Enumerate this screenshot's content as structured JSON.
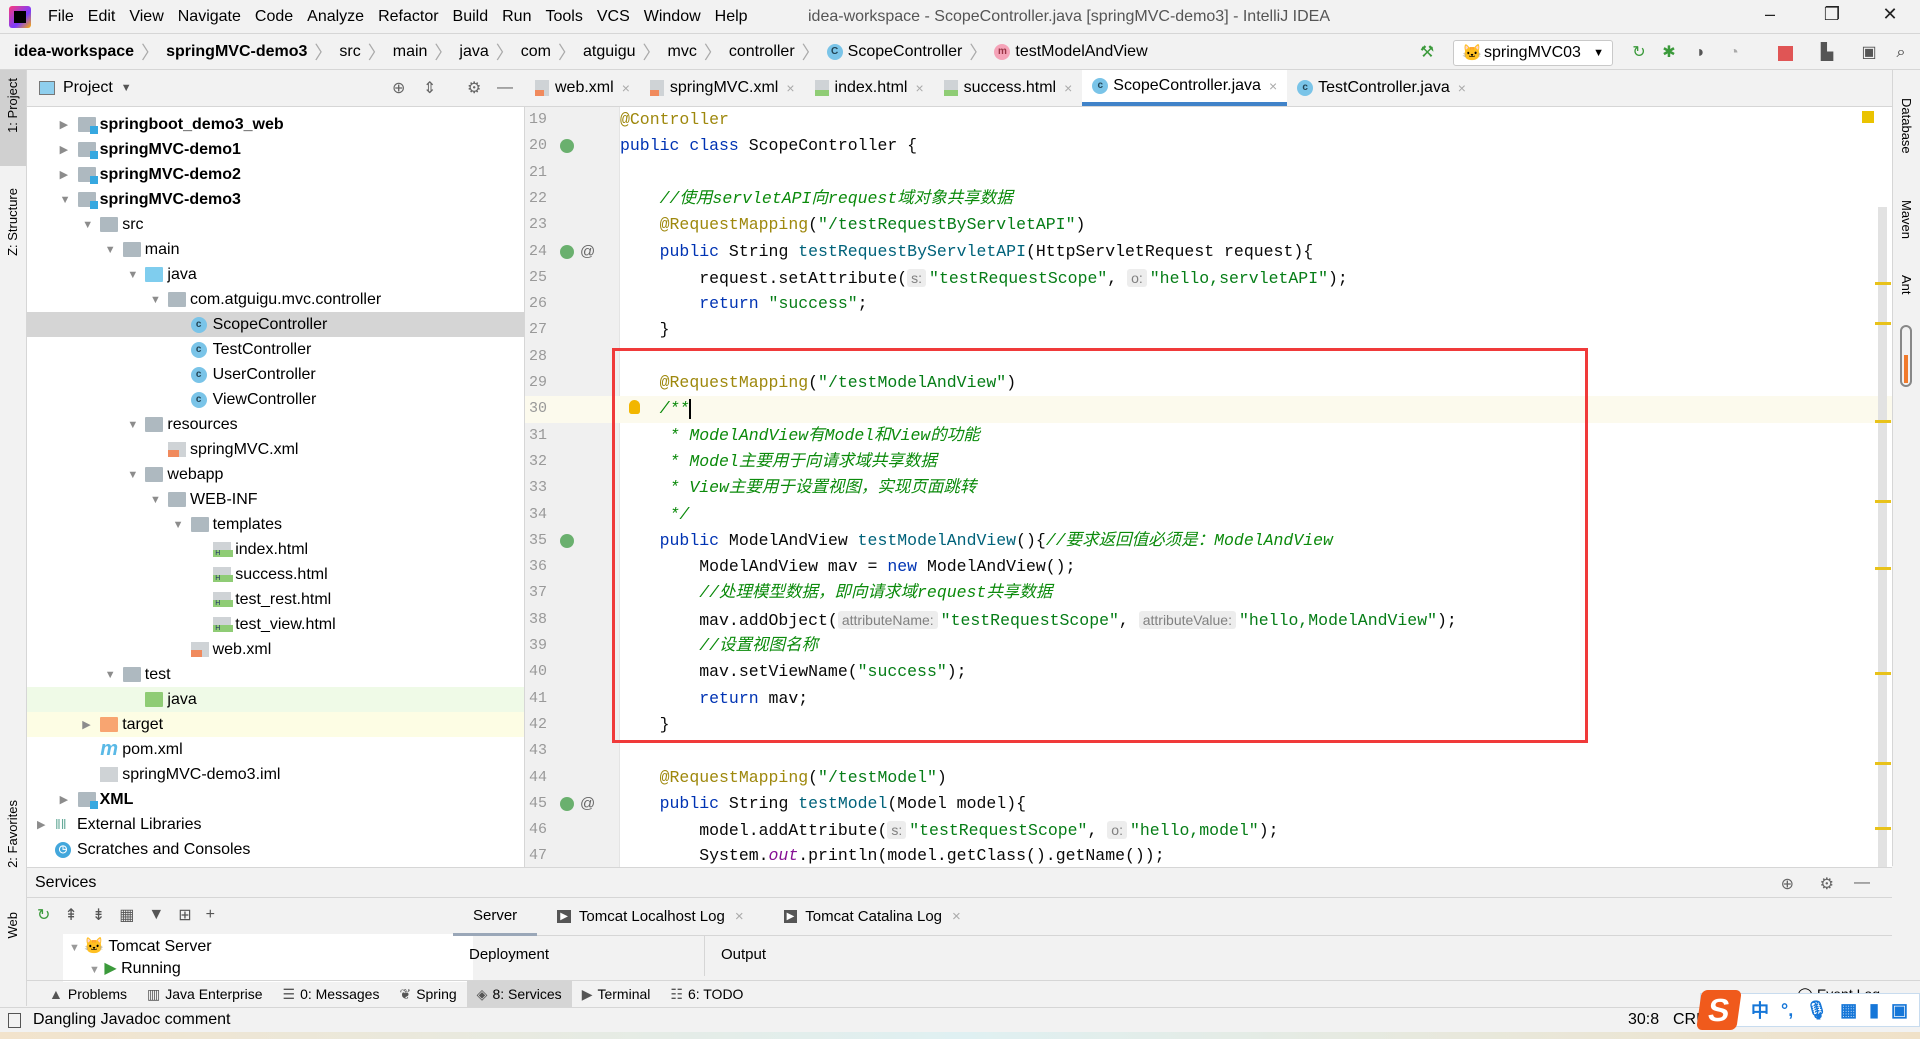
{
  "menubar": {
    "items": [
      "File",
      "Edit",
      "View",
      "Navigate",
      "Code",
      "Analyze",
      "Refactor",
      "Build",
      "Run",
      "Tools",
      "VCS",
      "Window",
      "Help"
    ],
    "title": "idea-workspace - ScopeController.java [springMVC-demo3] - IntelliJ IDEA",
    "window_controls": [
      "minimize",
      "restore",
      "close"
    ]
  },
  "breadcrumb": {
    "items": [
      "idea-workspace",
      "springMVC-demo3",
      "src",
      "main",
      "java",
      "com",
      "atguigu",
      "mvc",
      "controller",
      "ScopeController",
      "testModelAndView"
    ],
    "run_config": "springMVC03"
  },
  "left_strip": {
    "labels": [
      "1: Project",
      "Z: Structure",
      "2: Favorites",
      "Web"
    ]
  },
  "right_strip": {
    "labels": [
      "Database",
      "Maven",
      "Ant"
    ]
  },
  "project": {
    "title": "Project",
    "tree": [
      {
        "label": "springboot_demo3_web",
        "level": 1,
        "arrow": "collapsed",
        "icon": "module-folder",
        "bold": true
      },
      {
        "label": "springMVC-demo1",
        "level": 1,
        "arrow": "collapsed",
        "icon": "module-folder",
        "bold": true
      },
      {
        "label": "springMVC-demo2",
        "level": 1,
        "arrow": "collapsed",
        "icon": "module-folder",
        "bold": true
      },
      {
        "label": "springMVC-demo3",
        "level": 1,
        "arrow": "expanded",
        "icon": "module-folder",
        "bold": true
      },
      {
        "label": "src",
        "level": 2,
        "arrow": "expanded",
        "icon": "folder"
      },
      {
        "label": "main",
        "level": 3,
        "arrow": "expanded",
        "icon": "folder"
      },
      {
        "label": "java",
        "level": 4,
        "arrow": "expanded",
        "icon": "source-folder"
      },
      {
        "label": "com.atguigu.mvc.controller",
        "level": 5,
        "arrow": "expanded",
        "icon": "package"
      },
      {
        "label": "ScopeController",
        "level": 6,
        "icon": "class",
        "selected": true
      },
      {
        "label": "TestController",
        "level": 6,
        "icon": "class"
      },
      {
        "label": "UserController",
        "level": 6,
        "icon": "class"
      },
      {
        "label": "ViewController",
        "level": 6,
        "icon": "class"
      },
      {
        "label": "resources",
        "level": 4,
        "arrow": "expanded",
        "icon": "resources-folder"
      },
      {
        "label": "springMVC.xml",
        "level": 5,
        "icon": "xml-file"
      },
      {
        "label": "webapp",
        "level": 4,
        "arrow": "expanded",
        "icon": "web-folder"
      },
      {
        "label": "WEB-INF",
        "level": 5,
        "arrow": "expanded",
        "icon": "folder"
      },
      {
        "label": "templates",
        "level": 6,
        "arrow": "expanded",
        "icon": "folder"
      },
      {
        "label": "index.html",
        "level": 7,
        "icon": "html-file"
      },
      {
        "label": "success.html",
        "level": 7,
        "icon": "html-file"
      },
      {
        "label": "test_rest.html",
        "level": 7,
        "icon": "html-file"
      },
      {
        "label": "test_view.html",
        "level": 7,
        "icon": "html-file"
      },
      {
        "label": "web.xml",
        "level": 6,
        "icon": "xml-file"
      },
      {
        "label": "test",
        "level": 3,
        "arrow": "expanded",
        "icon": "folder"
      },
      {
        "label": "java",
        "level": 4,
        "icon": "test-folder",
        "highlight": "green"
      },
      {
        "label": "target",
        "level": 2,
        "arrow": "collapsed",
        "icon": "excluded-folder",
        "highlight": "yellow"
      },
      {
        "label": "pom.xml",
        "level": 2,
        "icon": "maven-file"
      },
      {
        "label": "springMVC-demo3.iml",
        "level": 2,
        "icon": "iml-file"
      },
      {
        "label": "XML",
        "level": 1,
        "arrow": "collapsed",
        "icon": "module-folder",
        "bold": true
      },
      {
        "label": "External Libraries",
        "level": 0,
        "arrow": "collapsed",
        "icon": "libraries"
      },
      {
        "label": "Scratches and Consoles",
        "level": 0,
        "icon": "scratches"
      }
    ]
  },
  "editor": {
    "tabs": [
      {
        "label": "web.xml",
        "icon": "xml"
      },
      {
        "label": "springMVC.xml",
        "icon": "xml"
      },
      {
        "label": "index.html",
        "icon": "html"
      },
      {
        "label": "success.html",
        "icon": "html"
      },
      {
        "label": "ScopeController.java",
        "icon": "class",
        "active": true
      },
      {
        "label": "TestController.java",
        "icon": "class"
      }
    ],
    "current_line": 30,
    "highlight_box_lines": [
      28,
      42
    ],
    "lines": [
      {
        "n": 19,
        "tokens": [
          {
            "t": "ann",
            "v": "@Controller"
          }
        ]
      },
      {
        "n": 20,
        "gutter": "bean",
        "tokens": [
          {
            "t": "kw",
            "v": "public"
          },
          {
            "t": "plain",
            "v": " "
          },
          {
            "t": "kw",
            "v": "class"
          },
          {
            "t": "plain",
            "v": " ScopeController {"
          }
        ]
      },
      {
        "n": 21,
        "tokens": []
      },
      {
        "n": 22,
        "tokens": [
          {
            "t": "plain",
            "v": "    "
          },
          {
            "t": "cmt",
            "v": "//使用servletAPI向request域对象共享数据"
          }
        ]
      },
      {
        "n": 23,
        "tokens": [
          {
            "t": "plain",
            "v": "    "
          },
          {
            "t": "ann",
            "v": "@RequestMapping"
          },
          {
            "t": "plain",
            "v": "("
          },
          {
            "t": "str",
            "v": "\"/testRequestByServletAPI\""
          },
          {
            "t": "plain",
            "v": ")"
          }
        ]
      },
      {
        "n": 24,
        "gutter": "bean",
        "at": true,
        "tokens": [
          {
            "t": "plain",
            "v": "    "
          },
          {
            "t": "kw",
            "v": "public"
          },
          {
            "t": "plain",
            "v": " String "
          },
          {
            "t": "fn",
            "v": "testRequestByServletAPI"
          },
          {
            "t": "plain",
            "v": "(HttpServletRequest request){"
          }
        ]
      },
      {
        "n": 25,
        "tokens": [
          {
            "t": "plain",
            "v": "        request.setAttribute("
          },
          {
            "t": "hint",
            "v": "s:"
          },
          {
            "t": "str",
            "v": "\"testRequestScope\""
          },
          {
            "t": "plain",
            "v": ", "
          },
          {
            "t": "hint",
            "v": "o:"
          },
          {
            "t": "str",
            "v": "\"hello,servletAPI\""
          },
          {
            "t": "plain",
            "v": ");"
          }
        ]
      },
      {
        "n": 26,
        "tokens": [
          {
            "t": "plain",
            "v": "        "
          },
          {
            "t": "kw",
            "v": "return"
          },
          {
            "t": "plain",
            "v": " "
          },
          {
            "t": "str",
            "v": "\"success\""
          },
          {
            "t": "plain",
            "v": ";"
          }
        ]
      },
      {
        "n": 27,
        "tokens": [
          {
            "t": "plain",
            "v": "    }"
          }
        ]
      },
      {
        "n": 28,
        "tokens": []
      },
      {
        "n": 29,
        "tokens": [
          {
            "t": "plain",
            "v": "    "
          },
          {
            "t": "ann",
            "v": "@RequestMapping"
          },
          {
            "t": "plain",
            "v": "("
          },
          {
            "t": "str",
            "v": "\"/testModelAndView\""
          },
          {
            "t": "plain",
            "v": ")"
          }
        ]
      },
      {
        "n": 30,
        "bulb": true,
        "caret": true,
        "tokens": [
          {
            "t": "plain",
            "v": "    "
          },
          {
            "t": "cmt",
            "v": "/**"
          }
        ]
      },
      {
        "n": 31,
        "tokens": [
          {
            "t": "plain",
            "v": "     "
          },
          {
            "t": "cmt",
            "v": "* ModelAndView有Model和View的功能"
          }
        ]
      },
      {
        "n": 32,
        "tokens": [
          {
            "t": "plain",
            "v": "     "
          },
          {
            "t": "cmt",
            "v": "* Model主要用于向请求域共享数据"
          }
        ]
      },
      {
        "n": 33,
        "tokens": [
          {
            "t": "plain",
            "v": "     "
          },
          {
            "t": "cmt",
            "v": "* View主要用于设置视图，实现页面跳转"
          }
        ]
      },
      {
        "n": 34,
        "tokens": [
          {
            "t": "plain",
            "v": "     "
          },
          {
            "t": "cmt",
            "v": "*/"
          }
        ]
      },
      {
        "n": 35,
        "gutter": "bean",
        "tokens": [
          {
            "t": "plain",
            "v": "    "
          },
          {
            "t": "kw",
            "v": "public"
          },
          {
            "t": "plain",
            "v": " ModelAndView "
          },
          {
            "t": "fn",
            "v": "testModelAndView"
          },
          {
            "t": "plain",
            "v": "(){"
          },
          {
            "t": "cmt",
            "v": "//要求返回值必须是：ModelAndView"
          }
        ]
      },
      {
        "n": 36,
        "tokens": [
          {
            "t": "plain",
            "v": "        ModelAndView mav = "
          },
          {
            "t": "kw",
            "v": "new"
          },
          {
            "t": "plain",
            "v": " ModelAndView();"
          }
        ]
      },
      {
        "n": 37,
        "tokens": [
          {
            "t": "plain",
            "v": "        "
          },
          {
            "t": "cmt",
            "v": "//处理模型数据，即向请求域request共享数据"
          }
        ]
      },
      {
        "n": 38,
        "tokens": [
          {
            "t": "plain",
            "v": "        mav.addObject("
          },
          {
            "t": "hint",
            "v": "attributeName:"
          },
          {
            "t": "str",
            "v": "\"testRequestScope\""
          },
          {
            "t": "plain",
            "v": ", "
          },
          {
            "t": "hint",
            "v": "attributeValue:"
          },
          {
            "t": "str",
            "v": "\"hello,ModelAndView\""
          },
          {
            "t": "plain",
            "v": ");"
          }
        ]
      },
      {
        "n": 39,
        "tokens": [
          {
            "t": "plain",
            "v": "        "
          },
          {
            "t": "cmt",
            "v": "//设置视图名称"
          }
        ]
      },
      {
        "n": 40,
        "tokens": [
          {
            "t": "plain",
            "v": "        mav.setViewName("
          },
          {
            "t": "str",
            "v": "\"success\""
          },
          {
            "t": "plain",
            "v": ");"
          }
        ]
      },
      {
        "n": 41,
        "tokens": [
          {
            "t": "plain",
            "v": "        "
          },
          {
            "t": "kw",
            "v": "return"
          },
          {
            "t": "plain",
            "v": " mav;"
          }
        ]
      },
      {
        "n": 42,
        "tokens": [
          {
            "t": "plain",
            "v": "    }"
          }
        ]
      },
      {
        "n": 43,
        "tokens": []
      },
      {
        "n": 44,
        "tokens": [
          {
            "t": "plain",
            "v": "    "
          },
          {
            "t": "ann",
            "v": "@RequestMapping"
          },
          {
            "t": "plain",
            "v": "("
          },
          {
            "t": "str",
            "v": "\"/testModel\""
          },
          {
            "t": "plain",
            "v": ")"
          }
        ]
      },
      {
        "n": 45,
        "gutter": "bean",
        "at": true,
        "tokens": [
          {
            "t": "plain",
            "v": "    "
          },
          {
            "t": "kw",
            "v": "public"
          },
          {
            "t": "plain",
            "v": " String "
          },
          {
            "t": "fn",
            "v": "testModel"
          },
          {
            "t": "plain",
            "v": "(Model model){"
          }
        ]
      },
      {
        "n": 46,
        "tokens": [
          {
            "t": "plain",
            "v": "        model.addAttribute("
          },
          {
            "t": "hint",
            "v": "s:"
          },
          {
            "t": "str",
            "v": "\"testRequestScope\""
          },
          {
            "t": "plain",
            "v": ", "
          },
          {
            "t": "hint",
            "v": "o:"
          },
          {
            "t": "str",
            "v": "\"hello,model\""
          },
          {
            "t": "plain",
            "v": ");"
          }
        ]
      },
      {
        "n": 47,
        "tokens": [
          {
            "t": "plain",
            "v": "        System."
          },
          {
            "t": "static",
            "v": "out"
          },
          {
            "t": "plain",
            "v": ".println(model.getClass().getName());"
          }
        ]
      }
    ]
  },
  "services": {
    "title": "Services",
    "tree": [
      "Tomcat Server",
      "Running"
    ],
    "tabs": [
      {
        "label": "Server",
        "active": true
      },
      {
        "label": "Tomcat Localhost Log"
      },
      {
        "label": "Tomcat Catalina Log"
      }
    ],
    "columns": [
      "Deployment",
      "Output"
    ]
  },
  "tool_buttons": [
    {
      "label": "Problems",
      "icon": "warning"
    },
    {
      "label": "Java Enterprise",
      "icon": "java-ee"
    },
    {
      "label": "0: Messages",
      "icon": "messages"
    },
    {
      "label": "Spring",
      "icon": "spring"
    },
    {
      "label": "8: Services",
      "icon": "services",
      "active": true
    },
    {
      "label": "Terminal",
      "icon": "terminal"
    },
    {
      "label": "6: TODO",
      "icon": "todo"
    }
  ],
  "event_log": "Event Log",
  "status": {
    "message": "Dangling Javadoc comment",
    "position": "30:8",
    "line_sep": "CRL"
  },
  "ime": {
    "logo": "S",
    "items": [
      "中",
      "°,",
      "🎤",
      "▦",
      "👕",
      "▣"
    ]
  },
  "colors": {
    "accent": "#4083c9",
    "highlight_box": "#f03a3a",
    "current_line": "#fcfaed",
    "keyword": "#0033b3",
    "string": "#067d17",
    "comment": "#0b8a0b",
    "annotation": "#9e880d"
  }
}
